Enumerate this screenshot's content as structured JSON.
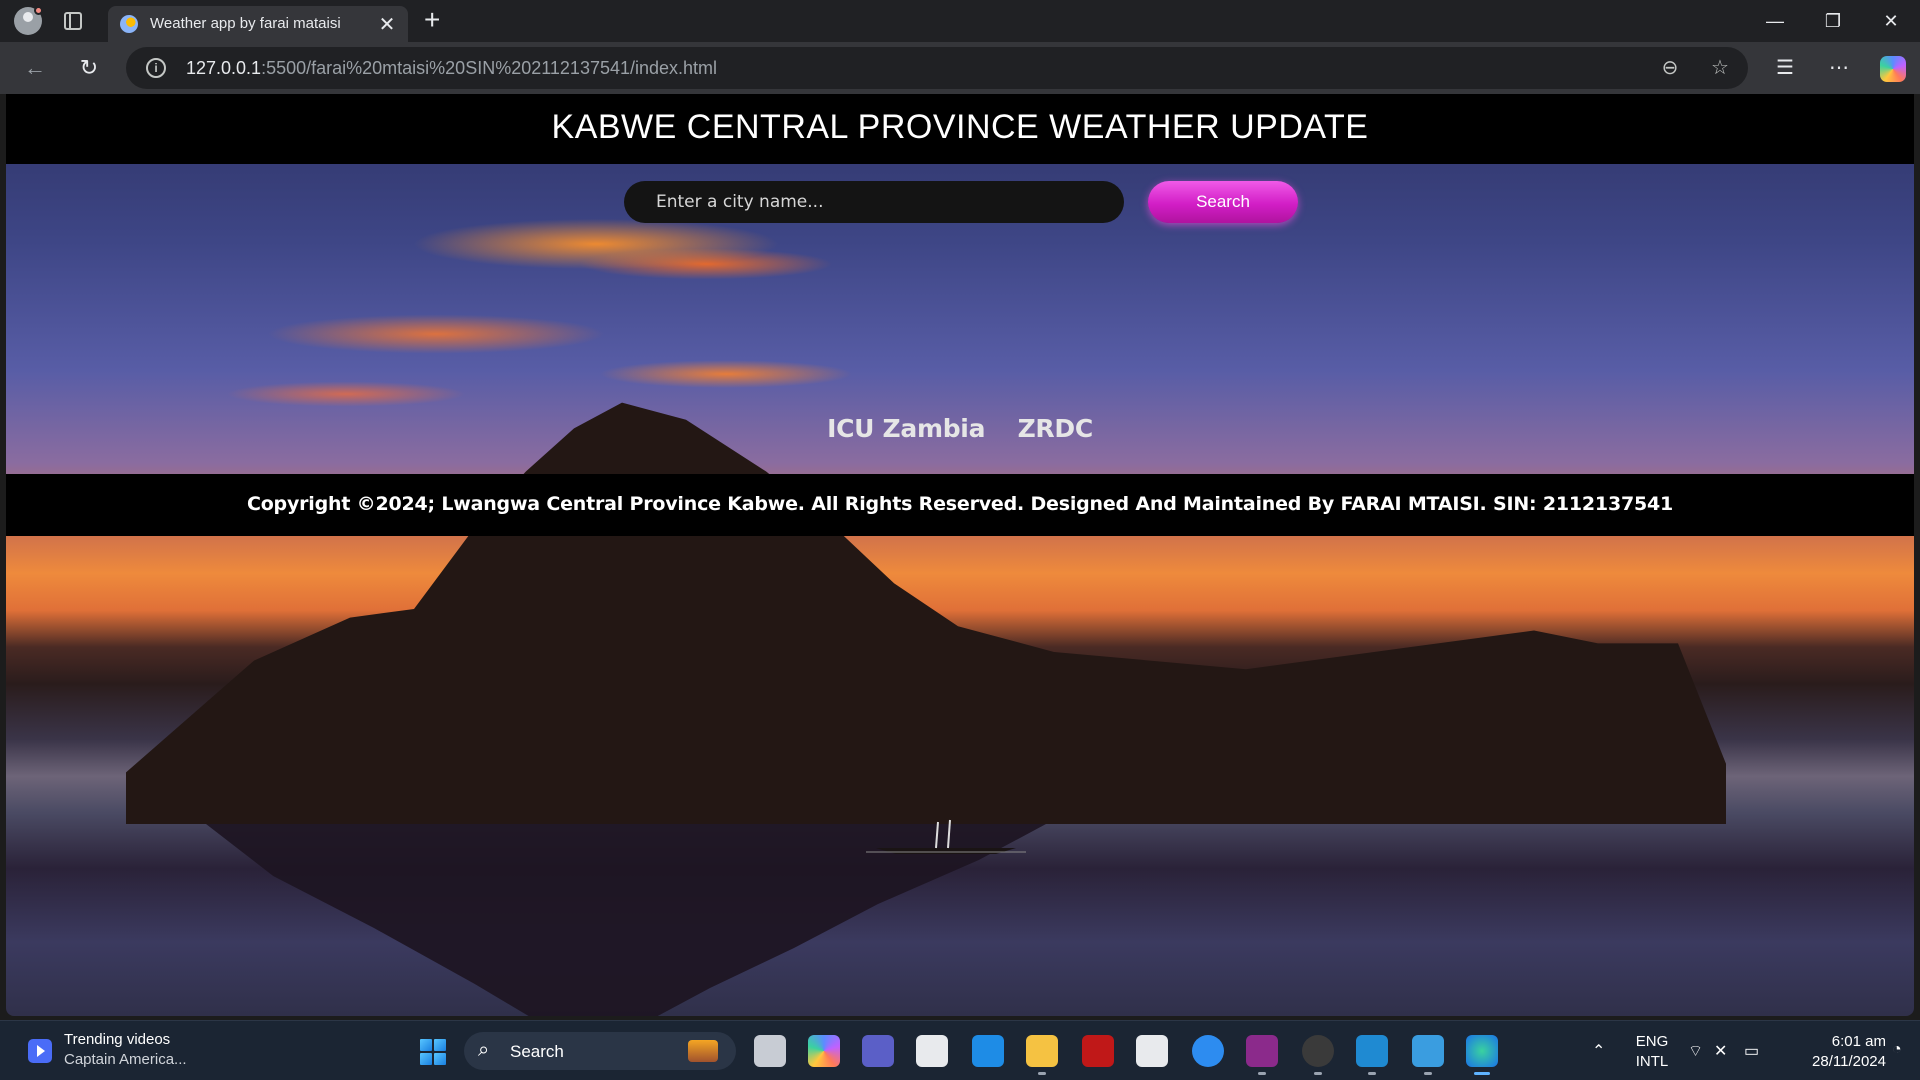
{
  "browser": {
    "tab_title": "Weather app by farai mataisi",
    "url_host": "127.0.0.1",
    "url_rest": ":5500/farai%20mtaisi%20SIN%202112137541/index.html"
  },
  "page": {
    "title": "KABWE CENTRAL PROVINCE WEATHER UPDATE",
    "search_placeholder": "Enter a city name...",
    "search_button": "Search",
    "links": [
      "ICU Zambia",
      "ZRDC"
    ],
    "copyright": "Copyright ©2024; Lwangwa Central Province Kabwe. All Rights Reserved. Designed And Maintained By FARAI MTAISI. SIN: 2112137541"
  },
  "taskbar": {
    "widget_title": "Trending videos",
    "widget_subtitle": "Captain America...",
    "search_label": "Search",
    "lang_top": "ENG",
    "lang_bottom": "INTL",
    "time": "6:01 am",
    "date": "28/11/2024"
  },
  "icons": {
    "back": "arrow-left-icon",
    "reload": "reload-icon",
    "info": "info-icon",
    "zoom": "zoom-out-icon",
    "favorite": "star-icon",
    "favorites": "favorites-icon",
    "menu": "more-icon"
  },
  "colors": {
    "search_button": "#d21ec6",
    "header_bg": "#000000",
    "taskbar_bg": "#1b2533"
  }
}
